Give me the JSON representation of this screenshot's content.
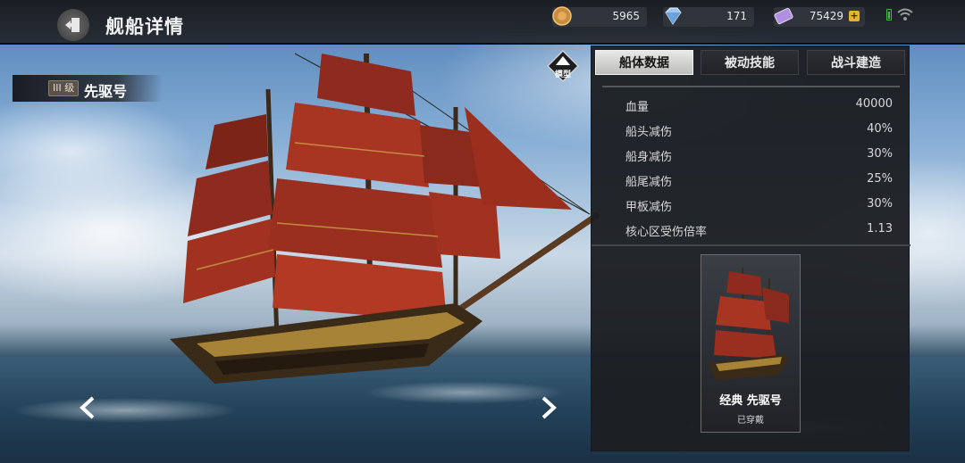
{
  "header": {
    "title": "舰船详情",
    "back_icon": "exit-door-icon"
  },
  "resources": {
    "gold": {
      "icon": "coin-icon",
      "value": "5965"
    },
    "gem": {
      "icon": "diamond-icon",
      "value": "171"
    },
    "ticket": {
      "icon": "ticket-icon",
      "value": "75429",
      "add": "+"
    }
  },
  "ship": {
    "tier": "III 级",
    "name": "先驱号"
  },
  "model_button": {
    "label": "模型"
  },
  "tabs": [
    {
      "label": "船体数据",
      "active": true
    },
    {
      "label": "被动技能",
      "active": false
    },
    {
      "label": "战斗建造",
      "active": false
    }
  ],
  "stats": [
    {
      "label": "血量",
      "value": "40000"
    },
    {
      "label": "船头减伤",
      "value": "40%"
    },
    {
      "label": "船身减伤",
      "value": "30%"
    },
    {
      "label": "船尾减伤",
      "value": "25%"
    },
    {
      "label": "甲板减伤",
      "value": "30%"
    },
    {
      "label": "核心区受伤倍率",
      "value": "1.13"
    }
  ],
  "skin": {
    "name": "经典 先驱号",
    "status": "已穿戴"
  },
  "colors": {
    "sail": "#8e2a1e",
    "hull": "#3a2a18",
    "active_tab": "#e0e0de",
    "currency_plus": "#e6b52a"
  }
}
